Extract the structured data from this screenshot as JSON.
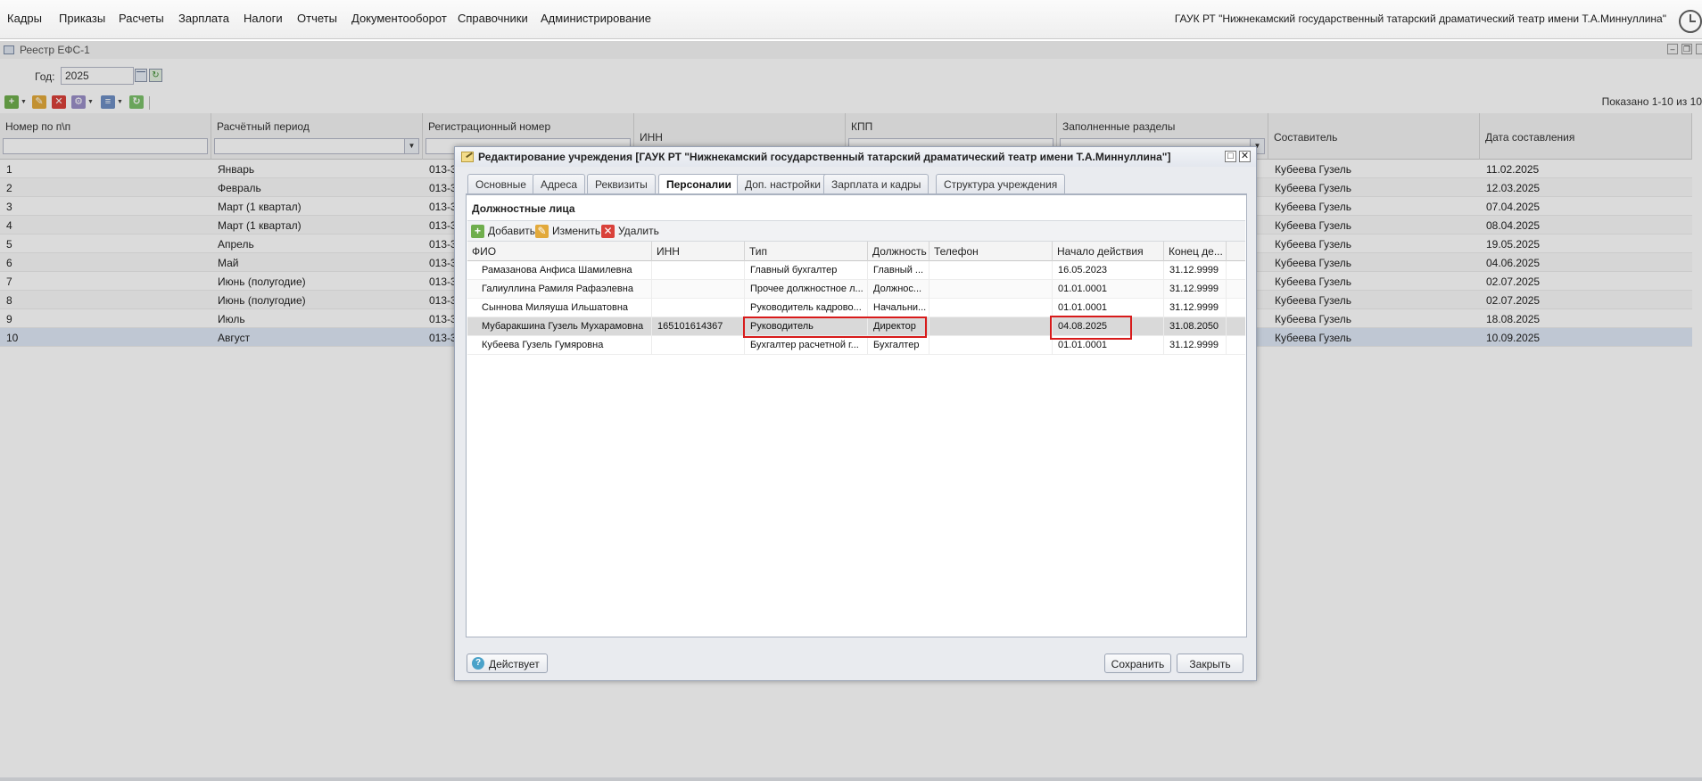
{
  "menu": {
    "items": [
      "Кадры",
      "Приказы",
      "Расчеты",
      "Зарплата",
      "Налоги",
      "Отчеты",
      "Документооборот",
      "Справочники",
      "Администрирование"
    ],
    "org": "ГАУК РТ \"Нижнекамский государственный татарский драматический театр имени Т.А.Миннуллина\""
  },
  "window": {
    "title": "Реестр ЕФС-1"
  },
  "filter": {
    "year_label": "Год:",
    "year_value": "2025"
  },
  "pager": {
    "text": "Показано 1-10 из 10"
  },
  "registry": {
    "columns": [
      "Номер по п\\п",
      "Расчётный период",
      "Регистрационный номер",
      "ИНН",
      "КПП",
      "Заполненные разделы",
      "Составитель",
      "Дата составления"
    ],
    "rows": [
      {
        "num": "1",
        "period": "Январь",
        "reg": "013-3",
        "author": "Кубеева Гузель",
        "date": "11.02.2025"
      },
      {
        "num": "2",
        "period": "Февраль",
        "reg": "013-3",
        "author": "Кубеева Гузель",
        "date": "12.03.2025"
      },
      {
        "num": "3",
        "period": "Март (1 квартал)",
        "reg": "013-3",
        "author": "Кубеева Гузель",
        "date": "07.04.2025"
      },
      {
        "num": "4",
        "period": "Март (1 квартал)",
        "reg": "013-3",
        "author": "Кубеева Гузель",
        "date": "08.04.2025"
      },
      {
        "num": "5",
        "period": "Апрель",
        "reg": "013-3",
        "author": "Кубеева Гузель",
        "date": "19.05.2025"
      },
      {
        "num": "6",
        "period": "Май",
        "reg": "013-3",
        "author": "Кубеева Гузель",
        "date": "04.06.2025"
      },
      {
        "num": "7",
        "period": "Июнь (полугодие)",
        "reg": "013-3",
        "author": "Кубеева Гузель",
        "date": "02.07.2025"
      },
      {
        "num": "8",
        "period": "Июнь (полугодие)",
        "reg": "013-3",
        "author": "Кубеева Гузель",
        "date": "02.07.2025"
      },
      {
        "num": "9",
        "period": "Июль",
        "reg": "013-3",
        "author": "Кубеева Гузель",
        "date": "18.08.2025"
      },
      {
        "num": "10",
        "period": "Август",
        "reg": "013-3",
        "author": "Кубеева Гузель",
        "date": "10.09.2025"
      }
    ]
  },
  "dialog": {
    "title": "Редактирование учреждения [ГАУК РТ \"Нижнекамский государственный татарский драматический театр имени Т.А.Миннуллина\"]",
    "tabs": [
      "Основные",
      "Адреса",
      "Реквизиты",
      "Персоналии",
      "Доп. настройки",
      "Зарплата и кадры",
      "Структура учреждения"
    ],
    "active_tab": "Персоналии",
    "section_title": "Должностные лица",
    "toolbar": {
      "add": "Добавить",
      "edit": "Изменить",
      "delete": "Удалить"
    },
    "columns": [
      "ФИО",
      "ИНН",
      "Тип",
      "Должность",
      "Телефон",
      "Начало действия",
      "Конец де..."
    ],
    "rows": [
      {
        "fio": "Рамазанова Анфиса Шамилевна",
        "inn": "",
        "type": "Главный бухгалтер",
        "position": "Главный ...",
        "phone": "",
        "start": "16.05.2023",
        "end": "31.12.9999"
      },
      {
        "fio": "Галиуллина Рамиля Рафаэлевна",
        "inn": "",
        "type": "Прочее должностное л...",
        "position": "Должнос...",
        "phone": "",
        "start": "01.01.0001",
        "end": "31.12.9999"
      },
      {
        "fio": "Сыннова Миляуша Ильшатовна",
        "inn": "",
        "type": "Руководитель кадрово...",
        "position": "Начальни...",
        "phone": "",
        "start": "01.01.0001",
        "end": "31.12.9999"
      },
      {
        "fio": "Мубаракшина Гузель Мухарамовна",
        "inn": "165101614367",
        "type": "Руководитель",
        "position": "Директор",
        "phone": "",
        "start": "04.08.2025",
        "end": "31.08.2050"
      },
      {
        "fio": "Кубеева Гузель Гумяровна",
        "inn": "",
        "type": "Бухгалтер расчетной г...",
        "position": "Бухгалтер",
        "phone": "",
        "start": "01.01.0001",
        "end": "31.12.9999"
      }
    ],
    "status_button": "Действует",
    "save_button": "Сохранить",
    "close_button": "Закрыть"
  },
  "colors": {
    "highlight": "#d81b1b",
    "selected_row": "#d9d9d9",
    "overlay": "rgba(0,0,0,0.14)"
  }
}
